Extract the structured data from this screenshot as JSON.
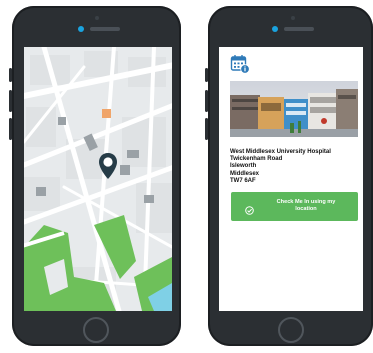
{
  "left_phone": {
    "map": {
      "marker_icon": "location-pin-icon"
    }
  },
  "right_phone": {
    "calendar_icon": "calendar-info-icon",
    "photo_alt": "West Middlesex University Hospital building",
    "address": {
      "line1": "West Middlesex University Hospital",
      "line2": "Twickenham Road",
      "line3": "Isleworth",
      "line4": "Middlesex",
      "line5": "TW7 6AF"
    },
    "check_in": {
      "label_line1": "Check Me In using my",
      "label_line2": "location",
      "icon": "check-circle-icon"
    }
  },
  "colors": {
    "accent_green": "#5cb85c",
    "map_park": "#6ec05a",
    "marker": "#263c47"
  }
}
